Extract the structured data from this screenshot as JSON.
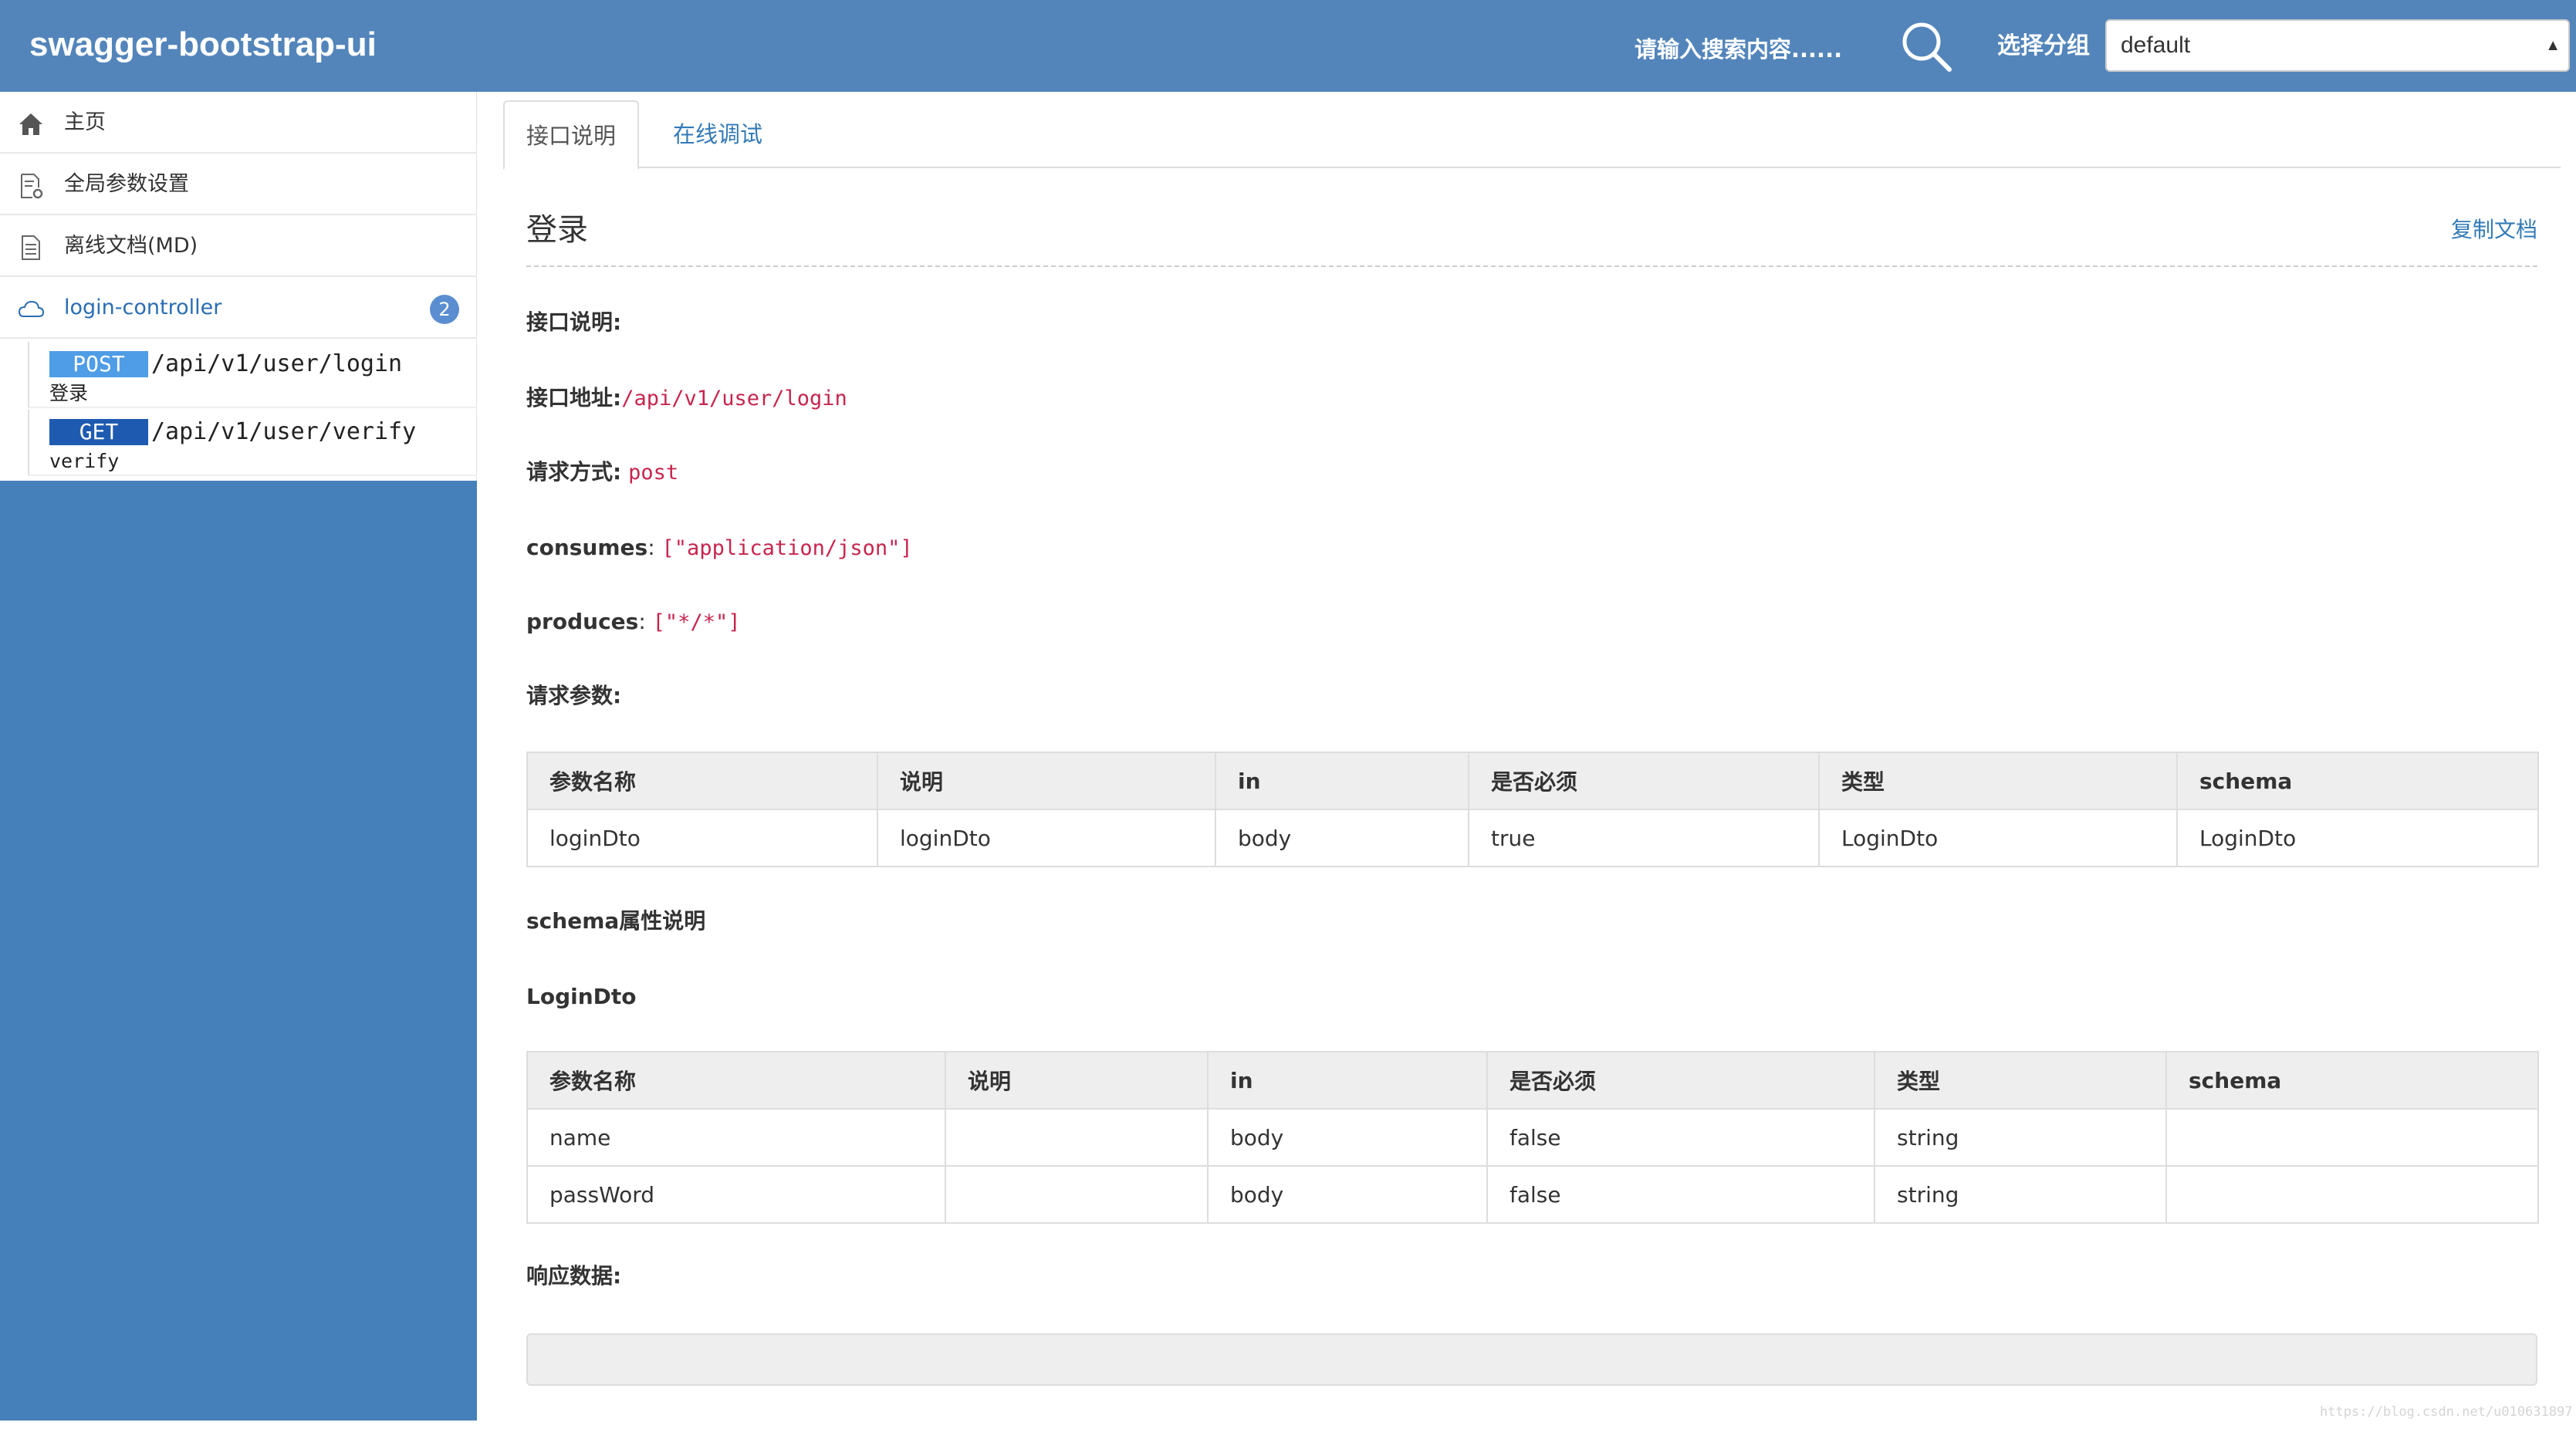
{
  "header": {
    "brand": "swagger-bootstrap-ui",
    "search_placeholder": "请输入搜索内容......",
    "group_label": "选择分组",
    "group_selected": "default"
  },
  "sidebar": {
    "nav": [
      {
        "label": "主页",
        "icon": "home-icon"
      },
      {
        "label": "全局参数设置",
        "icon": "settings-doc-icon"
      },
      {
        "label": "离线文档(MD)",
        "icon": "document-icon"
      },
      {
        "label": "login-controller",
        "icon": "cloud-icon",
        "badge": "2"
      }
    ],
    "apis": [
      {
        "method": "POST",
        "path": "/api/v1/user/login",
        "summary": "登录"
      },
      {
        "method": "GET",
        "path": "/api/v1/user/verify",
        "summary": "verify"
      }
    ]
  },
  "tabs": {
    "doc": "接口说明",
    "debug": "在线调试"
  },
  "doc": {
    "title": "登录",
    "copy_label": "复制文档",
    "desc_label": "接口说明:",
    "url_label": "接口地址:",
    "url_value": "/api/v1/user/login",
    "method_label": "请求方式:",
    "method_value": "post",
    "consumes_label": "consumes",
    "consumes_value": "[\"application/json\"]",
    "produces_label": "produces",
    "produces_value": "[\"*/*\"]",
    "params_label": "请求参数:",
    "params_table": {
      "headers": [
        "参数名称",
        "说明",
        "in",
        "是否必须",
        "类型",
        "schema"
      ],
      "rows": [
        [
          "loginDto",
          "loginDto",
          "body",
          "true",
          "LoginDto",
          "LoginDto"
        ]
      ]
    },
    "schema_section_label": "schema属性说明",
    "schema_name": "LoginDto",
    "schema_table": {
      "headers": [
        "参数名称",
        "说明",
        "in",
        "是否必须",
        "类型",
        "schema"
      ],
      "rows": [
        [
          "name",
          "",
          "body",
          "false",
          "string",
          ""
        ],
        [
          "passWord",
          "",
          "body",
          "false",
          "string",
          ""
        ]
      ]
    },
    "response_label": "响应数据:"
  },
  "watermark": "https://blog.csdn.net/u010631897",
  "colors": {
    "header_bg": "#5385bb",
    "sidebar_bg": "#4680bb",
    "post_badge": "#4e9de6",
    "get_badge": "#1e5bb0",
    "code_text": "#c7254e",
    "link": "#337ab7"
  }
}
